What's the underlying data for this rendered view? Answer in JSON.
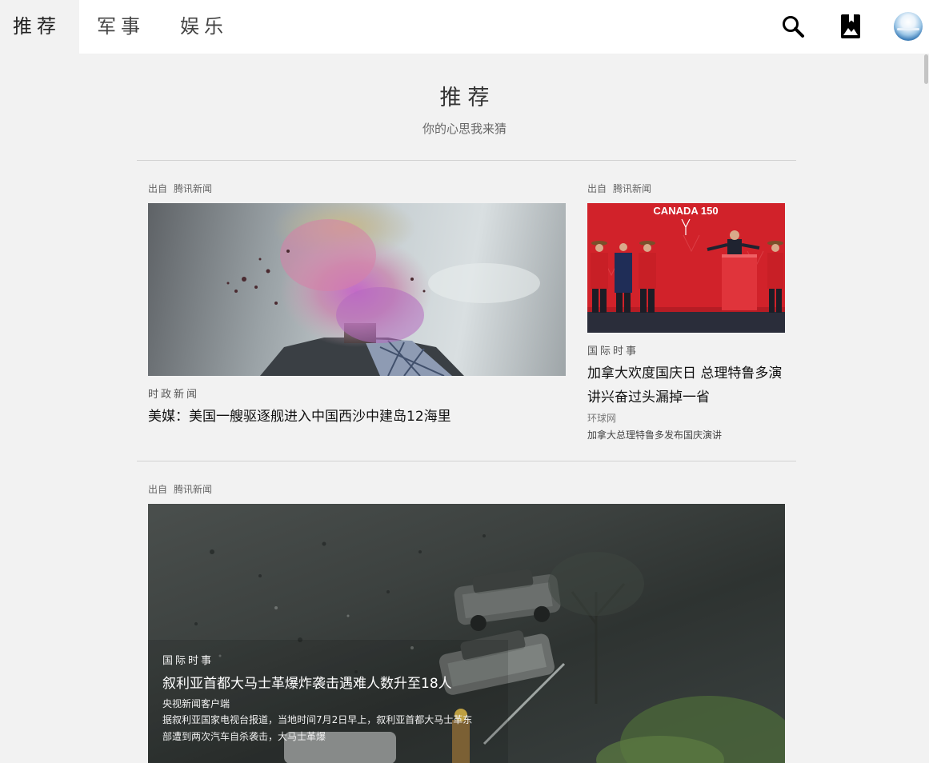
{
  "nav": {
    "tabs": [
      {
        "label": "推荐",
        "active": true
      },
      {
        "label": "军事",
        "active": false
      },
      {
        "label": "娱乐",
        "active": false
      }
    ],
    "icons": [
      "search-icon",
      "bookmark-icon",
      "avatar"
    ]
  },
  "section": {
    "title": "推荐",
    "subtitle": "你的心思我来猜"
  },
  "articles": [
    {
      "source_label": "出自",
      "source": "腾讯新闻",
      "category": "时政新闻",
      "title": "美媒：美国一艘驱逐舰进入中国西沙中建岛12海里"
    },
    {
      "source_label": "出自",
      "source": "腾讯新闻",
      "image_text": "CANADA 150",
      "category": "国际时事",
      "title_line1": "加拿大欢度国庆日 总理特鲁多演",
      "title_line2": "讲兴奋过头漏掉一省",
      "outlet": "环球网",
      "summary": "加拿大总理特鲁多发布国庆演讲"
    },
    {
      "source_label": "出自",
      "source": "腾讯新闻",
      "category": "国际时事",
      "title": "叙利亚首都大马士革爆炸袭击遇难人数升至18人",
      "outlet": "央视新闻客户端",
      "summary_line1": "据叙利亚国家电视台报道，当地时间7月2日早上，叙利亚首都大马士革东",
      "summary_line2": "部遭到两次汽车自杀袭击，大马士革爆"
    }
  ],
  "colors": {
    "background": "#f2f2f2",
    "topbar": "#ffffff",
    "canada_red": "#d1222a"
  }
}
